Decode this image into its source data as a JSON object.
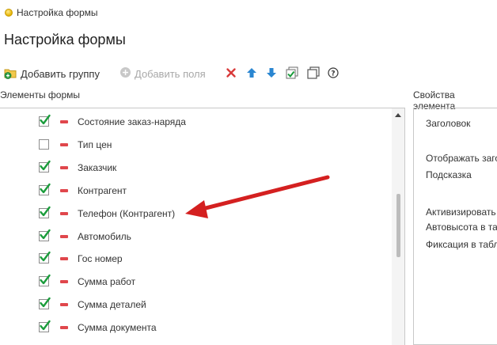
{
  "window": {
    "title": "Настройка формы"
  },
  "page": {
    "title": "Настройка формы"
  },
  "toolbar": {
    "add_group": "Добавить группу",
    "add_fields": "Добавить поля"
  },
  "left_panel": {
    "label": "Элементы формы"
  },
  "right_panel": {
    "label": "Свойства элемента"
  },
  "elements": [
    {
      "label": "Состояние заказ-наряда",
      "checked": true
    },
    {
      "label": "Тип цен",
      "checked": false
    },
    {
      "label": "Заказчик",
      "checked": true
    },
    {
      "label": "Контрагент",
      "checked": true
    },
    {
      "label": "Телефон (Контрагент)",
      "checked": true
    },
    {
      "label": "Автомобиль",
      "checked": true
    },
    {
      "label": "Гос номер",
      "checked": true
    },
    {
      "label": "Сумма работ",
      "checked": true
    },
    {
      "label": "Сумма деталей",
      "checked": true
    },
    {
      "label": "Сумма документа",
      "checked": true
    }
  ],
  "properties": [
    "Заголовок",
    "Отображать заголовок",
    "Подсказка",
    "Активизировать по умолчанию",
    "Автовысота в таблице",
    "Фиксация в таблице"
  ],
  "colors": {
    "check": "#1a9c3b",
    "remove": "#e0474c",
    "annotation_arrow": "#d42020",
    "move_arrows": "#2a86d1"
  }
}
